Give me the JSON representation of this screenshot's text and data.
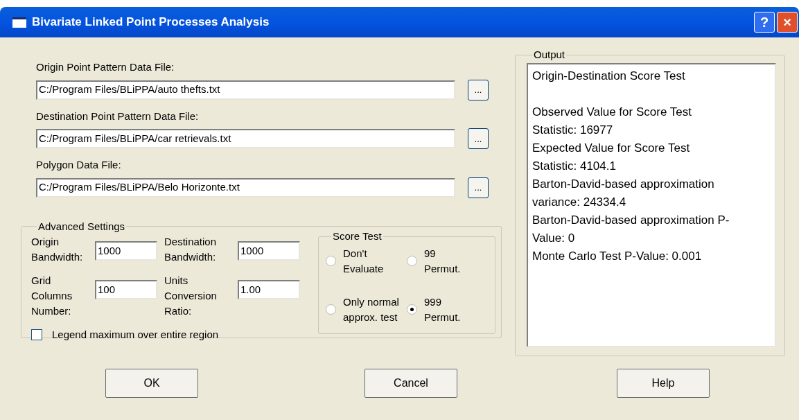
{
  "window": {
    "title": "Bivariate Linked Point Processes Analysis",
    "title_buttons": [
      {
        "kind": "help",
        "label": "?"
      },
      {
        "kind": "close",
        "label": "×"
      }
    ]
  },
  "files": [
    {
      "label": "Origin Point Pattern Data File:",
      "value": "C:/Program Files/BLiPPA/auto thefts.txt",
      "browse": "..."
    },
    {
      "label": "Destination Point Pattern Data File:",
      "value": "C:/Program Files/BLiPPA/car retrievals.txt",
      "browse": "..."
    },
    {
      "label": "Polygon Data File:",
      "value": "C:/Program Files/BLiPPA/Belo Horizonte.txt",
      "browse": "..."
    }
  ],
  "advanced_settings": {
    "title": "Advanced Settings",
    "fields": [
      {
        "label_lines": [
          "Origin",
          "Bandwidth:"
        ],
        "value": "1000"
      },
      {
        "label_lines": [
          "Destination",
          "Bandwidth:"
        ],
        "value": "1000"
      },
      {
        "label_lines": [
          "Grid",
          "Columns",
          "Number:"
        ],
        "value": "100"
      },
      {
        "label_lines": [
          "Units",
          "Conversion",
          "Ratio:"
        ],
        "value": "1.00"
      }
    ],
    "checkbox": {
      "label": "Legend maximum over entire region",
      "checked": false
    }
  },
  "score_test": {
    "title": "Score Test",
    "options": [
      {
        "label_lines": [
          "Don't",
          "Evaluate"
        ],
        "selected": false
      },
      {
        "label_lines": [
          "99",
          "Permut."
        ],
        "selected": false
      },
      {
        "label_lines": [
          "Only normal",
          "approx. test"
        ],
        "selected": false
      },
      {
        "label_lines": [
          "999",
          "Permut."
        ],
        "selected": true
      }
    ]
  },
  "output": {
    "title": "Output",
    "paragraphs": [
      [
        "Origin-Destination Score Test"
      ],
      [
        "Observed Value for Score Test",
        "Statistic: 16977",
        "Expected Value for Score Test",
        "Statistic: 4104.1",
        "Barton-David-based approximation",
        "variance: 24334.4",
        "Barton-David-based approximation P-",
        "Value: 0",
        "Monte Carlo Test P-Value: 0.001"
      ]
    ]
  },
  "buttons": [
    "OK",
    "Cancel",
    "Help"
  ]
}
